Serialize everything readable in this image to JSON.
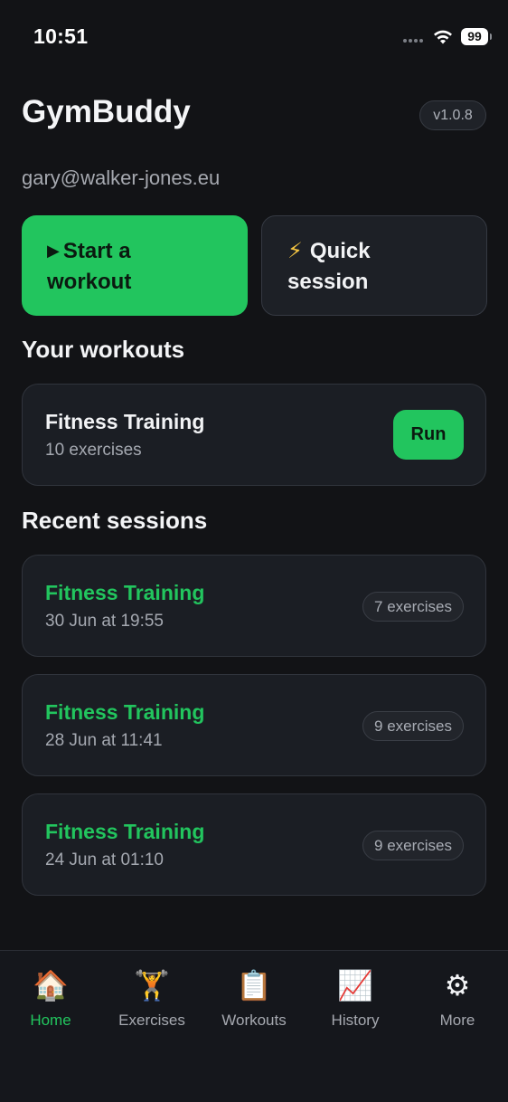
{
  "status_bar": {
    "time": "10:51",
    "battery": "99"
  },
  "header": {
    "app_title": "GymBuddy",
    "version": "v1.0.8",
    "user_email": "gary@walker-jones.eu"
  },
  "actions": {
    "start": {
      "icon": "▶",
      "line1": "Start a",
      "line2": "workout"
    },
    "quick": {
      "icon": "⚡",
      "line1": "Quick",
      "line2": "session"
    }
  },
  "workouts_section": {
    "title": "Your workouts",
    "items": [
      {
        "title": "Fitness Training",
        "subtitle": "10 exercises",
        "button": "Run"
      }
    ]
  },
  "recent_section": {
    "title": "Recent sessions",
    "items": [
      {
        "title": "Fitness Training",
        "date": "30 Jun at 19:55",
        "count": "7 exercises"
      },
      {
        "title": "Fitness Training",
        "date": "28 Jun at 11:41",
        "count": "9 exercises"
      },
      {
        "title": "Fitness Training",
        "date": "24 Jun at 01:10",
        "count": "9 exercises"
      }
    ]
  },
  "tab_bar": {
    "active": "home",
    "tabs": [
      {
        "icon": "🏠",
        "icon_name": "home-icon",
        "label": "Home"
      },
      {
        "icon": "🏋",
        "icon_name": "weightlifter-icon",
        "label": "Exercises"
      },
      {
        "icon": "📋",
        "icon_name": "clipboard-icon",
        "label": "Workouts"
      },
      {
        "icon": "📈",
        "icon_name": "chart-up-icon",
        "label": "History"
      },
      {
        "icon": "⚙",
        "icon_name": "gear-icon",
        "label": "More"
      }
    ]
  },
  "colors": {
    "accent": "#22c55e",
    "background": "#121316",
    "card": "#1b1e24",
    "muted_text": "#a6a9b0"
  }
}
